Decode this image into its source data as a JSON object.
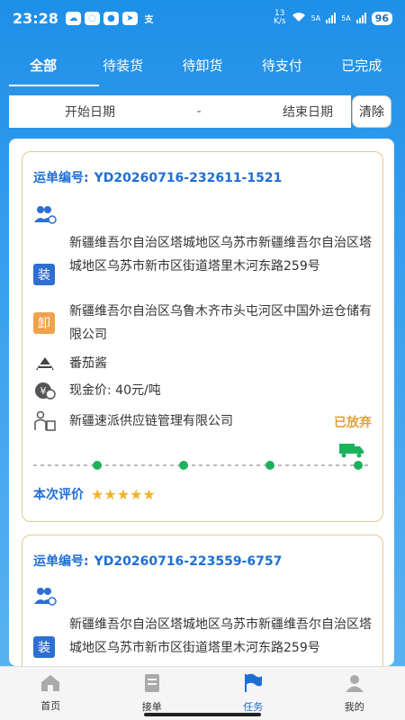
{
  "status_bar": {
    "time": "23:28",
    "net_speed_top": "13",
    "net_speed_bottom": "K/s",
    "sig1": "5A",
    "sig2": "5A",
    "battery": "96"
  },
  "tabs": [
    {
      "label": "全部",
      "active": true
    },
    {
      "label": "待装货",
      "active": false
    },
    {
      "label": "待卸货",
      "active": false
    },
    {
      "label": "待支付",
      "active": false
    },
    {
      "label": "已完成",
      "active": false
    }
  ],
  "filter": {
    "start_placeholder": "开始日期",
    "separator": "-",
    "end_placeholder": "结束日期",
    "clear_label": "清除"
  },
  "orders": [
    {
      "label": "运单编号:",
      "number": "YD20260716-232611-1521",
      "load_badge": "装",
      "load_address": "新疆维吾尔自治区塔城地区乌苏市新疆维吾尔自治区塔城地区乌苏市新市区街道塔里木河东路259号",
      "unload_badge": "卸",
      "unload_address": "新疆维吾尔自治区乌鲁木齐市头屯河区中国外运仓储有限公司",
      "goods": "番茄酱",
      "price": "现金价: 40元/吨",
      "company": "新疆速派供应链管理有限公司",
      "status": "已放弃",
      "rating_label": "本次评价",
      "stars": "★★★★★",
      "star_count": 5
    },
    {
      "label": "运单编号:",
      "number": "YD20260716-223559-6757",
      "load_badge": "装",
      "load_address": "新疆维吾尔自治区塔城地区乌苏市新疆维吾尔自治区塔城地区乌苏市新市区街道塔里木河东路259号"
    }
  ],
  "bottom_nav": [
    {
      "label": "首页",
      "icon": "home-icon",
      "active": false
    },
    {
      "label": "接单",
      "icon": "document-icon",
      "active": false
    },
    {
      "label": "任务",
      "icon": "flag-icon",
      "active": true
    },
    {
      "label": "我的",
      "icon": "user-icon",
      "active": false
    }
  ],
  "colors": {
    "primary": "#1f6fd3",
    "accent_orange": "#f0a24a",
    "progress_green": "#1bb35a",
    "star": "#f3b22c"
  }
}
